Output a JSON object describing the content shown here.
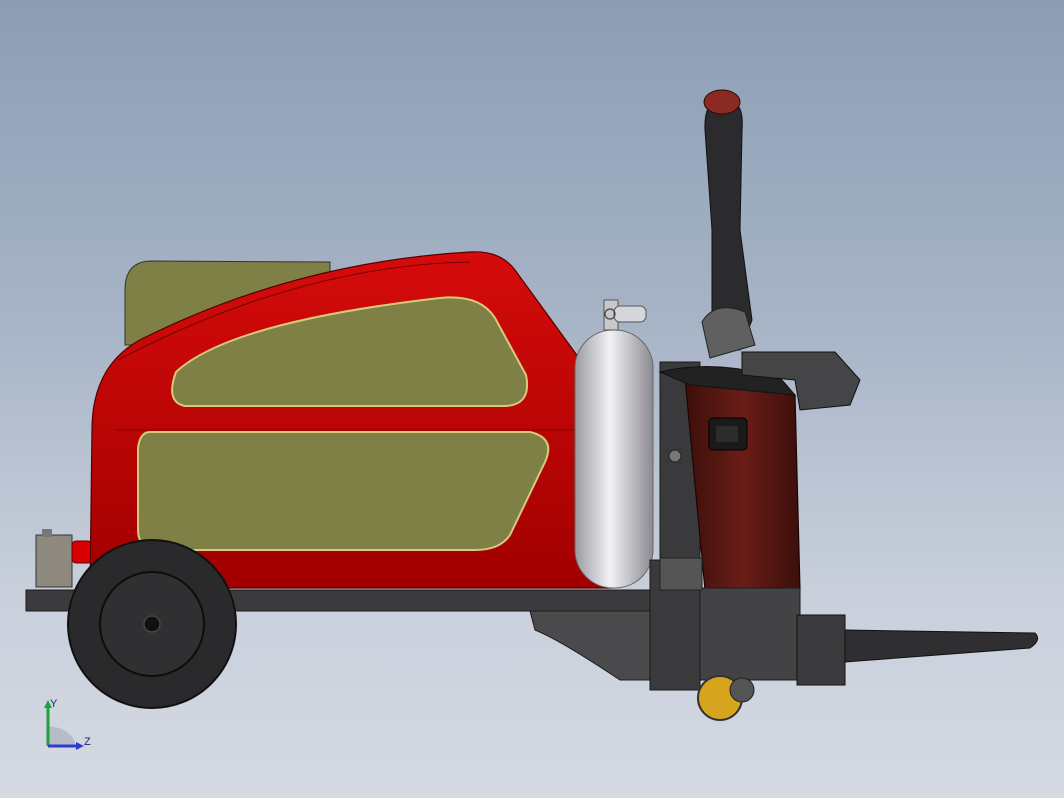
{
  "viewport": {
    "background_top": "#8c9db4",
    "background_bottom": "#d5d9e2"
  },
  "model": {
    "body_color": "#c00000",
    "panel_color": "#7f8045",
    "frame_color": "#3a3a3a",
    "cylinder_color": "#d8d8dc",
    "mast_color": "#5a1a14"
  },
  "triad": {
    "y_label": "Y",
    "z_label": "Z",
    "y_color": "#1fa13a",
    "z_color": "#2a3fd0"
  }
}
